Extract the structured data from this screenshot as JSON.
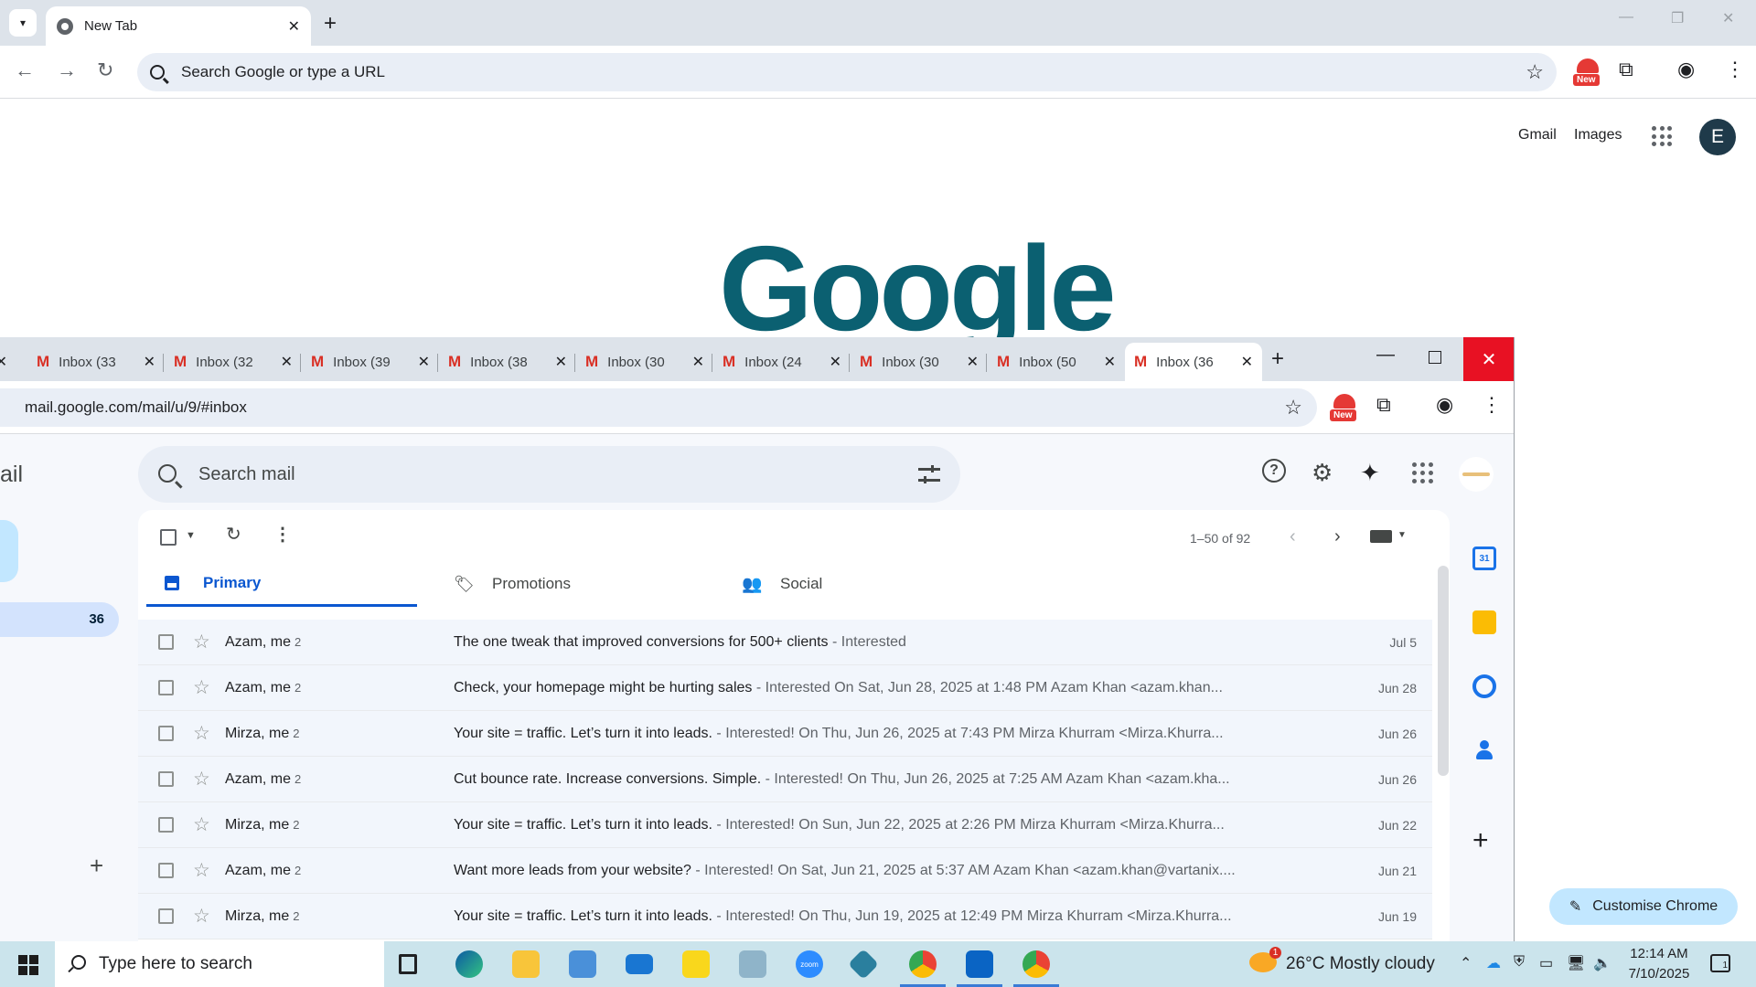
{
  "bg_window": {
    "tab_title": "New Tab",
    "omnibox_placeholder": "Search Google or type a URL",
    "ext_badge": "New",
    "links": {
      "gmail": "Gmail",
      "images": "Images"
    },
    "avatar_letter": "E",
    "logo_text": "Google",
    "customise_label": "Customise Chrome",
    "colors": {
      "logo": "#0b6071",
      "customise_bg": "#c2e7ff",
      "tabstrip": "#dde3ea"
    }
  },
  "gmail_window": {
    "tabs": [
      {
        "label": "Inbox (33"
      },
      {
        "label": "Inbox (32"
      },
      {
        "label": "Inbox (39"
      },
      {
        "label": "Inbox (38"
      },
      {
        "label": "Inbox (30"
      },
      {
        "label": "Inbox (24"
      },
      {
        "label": "Inbox (30"
      },
      {
        "label": "Inbox (50"
      },
      {
        "label": "Inbox (36",
        "active": true
      }
    ],
    "url": "mail.google.com/mail/u/9/#inbox",
    "ext_badge": "New",
    "brand_fragment": "ail",
    "search_placeholder": "Search mail",
    "inbox_count": "36",
    "range": "1–50 of 92",
    "categories": [
      {
        "label": "Primary",
        "icon": "inbox-icon",
        "active": true
      },
      {
        "label": "Promotions",
        "icon": "tag-icon"
      },
      {
        "label": "Social",
        "icon": "people-icon"
      }
    ],
    "rows": [
      {
        "from": "Azam, me",
        "count": "2",
        "subject": "The one tweak that improved conversions for 500+ clients",
        "snippet": " - Interested",
        "date": "Jul 5"
      },
      {
        "from": "Azam, me",
        "count": "2",
        "subject": "Check, your homepage might be hurting sales",
        "snippet": " - Interested On Sat, Jun 28, 2025 at 1:48 PM Azam Khan <azam.khan...",
        "date": "Jun 28"
      },
      {
        "from": "Mirza, me",
        "count": "2",
        "subject": "Your site = traffic. Let’s turn it into leads.",
        "snippet": " - Interested! On Thu, Jun 26, 2025 at 7:43 PM Mirza Khurram <Mirza.Khurra...",
        "date": "Jun 26"
      },
      {
        "from": "Azam, me",
        "count": "2",
        "subject": "Cut bounce rate. Increase conversions. Simple.",
        "snippet": " - Interested! On Thu, Jun 26, 2025 at 7:25 AM Azam Khan <azam.kha...",
        "date": "Jun 26"
      },
      {
        "from": "Mirza, me",
        "count": "2",
        "subject": "Your site = traffic. Let’s turn it into leads.",
        "snippet": " - Interested! On Sun, Jun 22, 2025 at 2:26 PM Mirza Khurram <Mirza.Khurra...",
        "date": "Jun 22"
      },
      {
        "from": "Azam, me",
        "count": "2",
        "subject": "Want more leads from your website?",
        "snippet": " - Interested! On Sat, Jun 21, 2025 at 5:37 AM Azam Khan <azam.khan@vartanix....",
        "date": "Jun 21"
      },
      {
        "from": "Mirza, me",
        "count": "2",
        "subject": "Your site = traffic. Let’s turn it into leads.",
        "snippet": " - Interested! On Thu, Jun 19, 2025 at 12:49 PM Mirza Khurram <Mirza.Khurra...",
        "date": "Jun 19"
      }
    ],
    "calendar_day": "31",
    "colors": {
      "accent": "#0b57d0",
      "close_red": "#e81123",
      "row_bg": "#f2f6fc"
    }
  },
  "taskbar": {
    "search_placeholder": "Type here to search",
    "zoom_label": "zoom",
    "weather": "26°C  Mostly cloudy",
    "weather_alert": "1",
    "time": "12:14 AM",
    "date": "7/10/2025",
    "notifications": "1",
    "apps": [
      "task-view",
      "edge",
      "file-explorer",
      "store",
      "mail",
      "sticky-notes",
      "notes",
      "zoom",
      "app",
      "chrome",
      "outlook",
      "chrome-active"
    ]
  }
}
